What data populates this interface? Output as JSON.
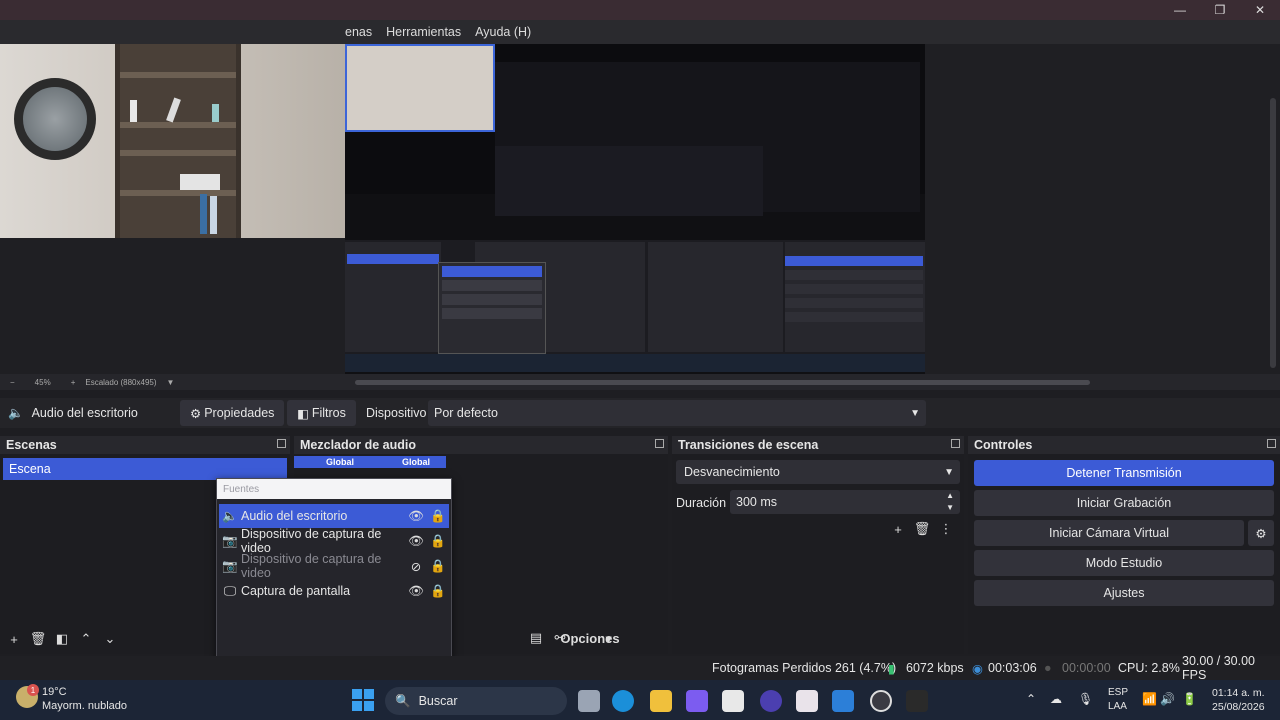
{
  "menu": {
    "items": [
      "enas",
      "Herramientas",
      "Ayuda (H)"
    ]
  },
  "zoom": {
    "minus": "−",
    "level": "45%",
    "plus": "+",
    "scale_mode": "Escalado (880x495)"
  },
  "source_bar": {
    "source_name": "Audio del escritorio",
    "properties_label": "Propiedades",
    "filters_label": "Filtros",
    "device_label": "Dispositivo",
    "device_value": "Por defecto"
  },
  "scenes": {
    "title": "Escenas",
    "items": [
      "Escena"
    ]
  },
  "mixer": {
    "title": "Mezclador de audio",
    "col1": "Global",
    "col2": "Global",
    "options_label": "Opciones"
  },
  "sources_popup": {
    "title": "Fuentes",
    "items": [
      {
        "name": "Audio del escritorio",
        "icon": "speaker-icon"
      },
      {
        "name": "Dispositivo de captura de video",
        "icon": "camera-icon"
      },
      {
        "name": "Dispositivo de captura de video",
        "icon": "camera-icon"
      },
      {
        "name": "Captura de pantalla",
        "icon": "monitor-icon"
      }
    ]
  },
  "transitions": {
    "title": "Transiciones de escena",
    "selected": "Desvanecimiento",
    "duration_label": "Duración",
    "duration_value": "300 ms"
  },
  "controls": {
    "title": "Controles",
    "stop_stream": "Detener Transmisión",
    "start_recording": "Iniciar Grabación",
    "start_virtual_cam": "Iniciar Cámara Virtual",
    "studio_mode": "Modo Estudio",
    "settings": "Ajustes"
  },
  "status": {
    "dropped_frames": "Fotogramas Perdidos 261 (4.7%)",
    "bitrate": "6072 kbps",
    "stream_time": "00:03:06",
    "rec_time": "00:00:00",
    "cpu": "CPU: 2.8%",
    "fps": "30.00 / 30.00 FPS"
  },
  "taskbar": {
    "weather_temp": "19°C",
    "weather_desc": "Mayorm. nublado",
    "weather_badge": "1",
    "search_placeholder": "Buscar",
    "lang_line1": "ESP",
    "lang_line2": "LAA",
    "time": "01:14 a. m.",
    "date": "25/08/2026"
  },
  "colors": {
    "accent": "#3c5bd6",
    "bitrate_green": "#38c172"
  }
}
